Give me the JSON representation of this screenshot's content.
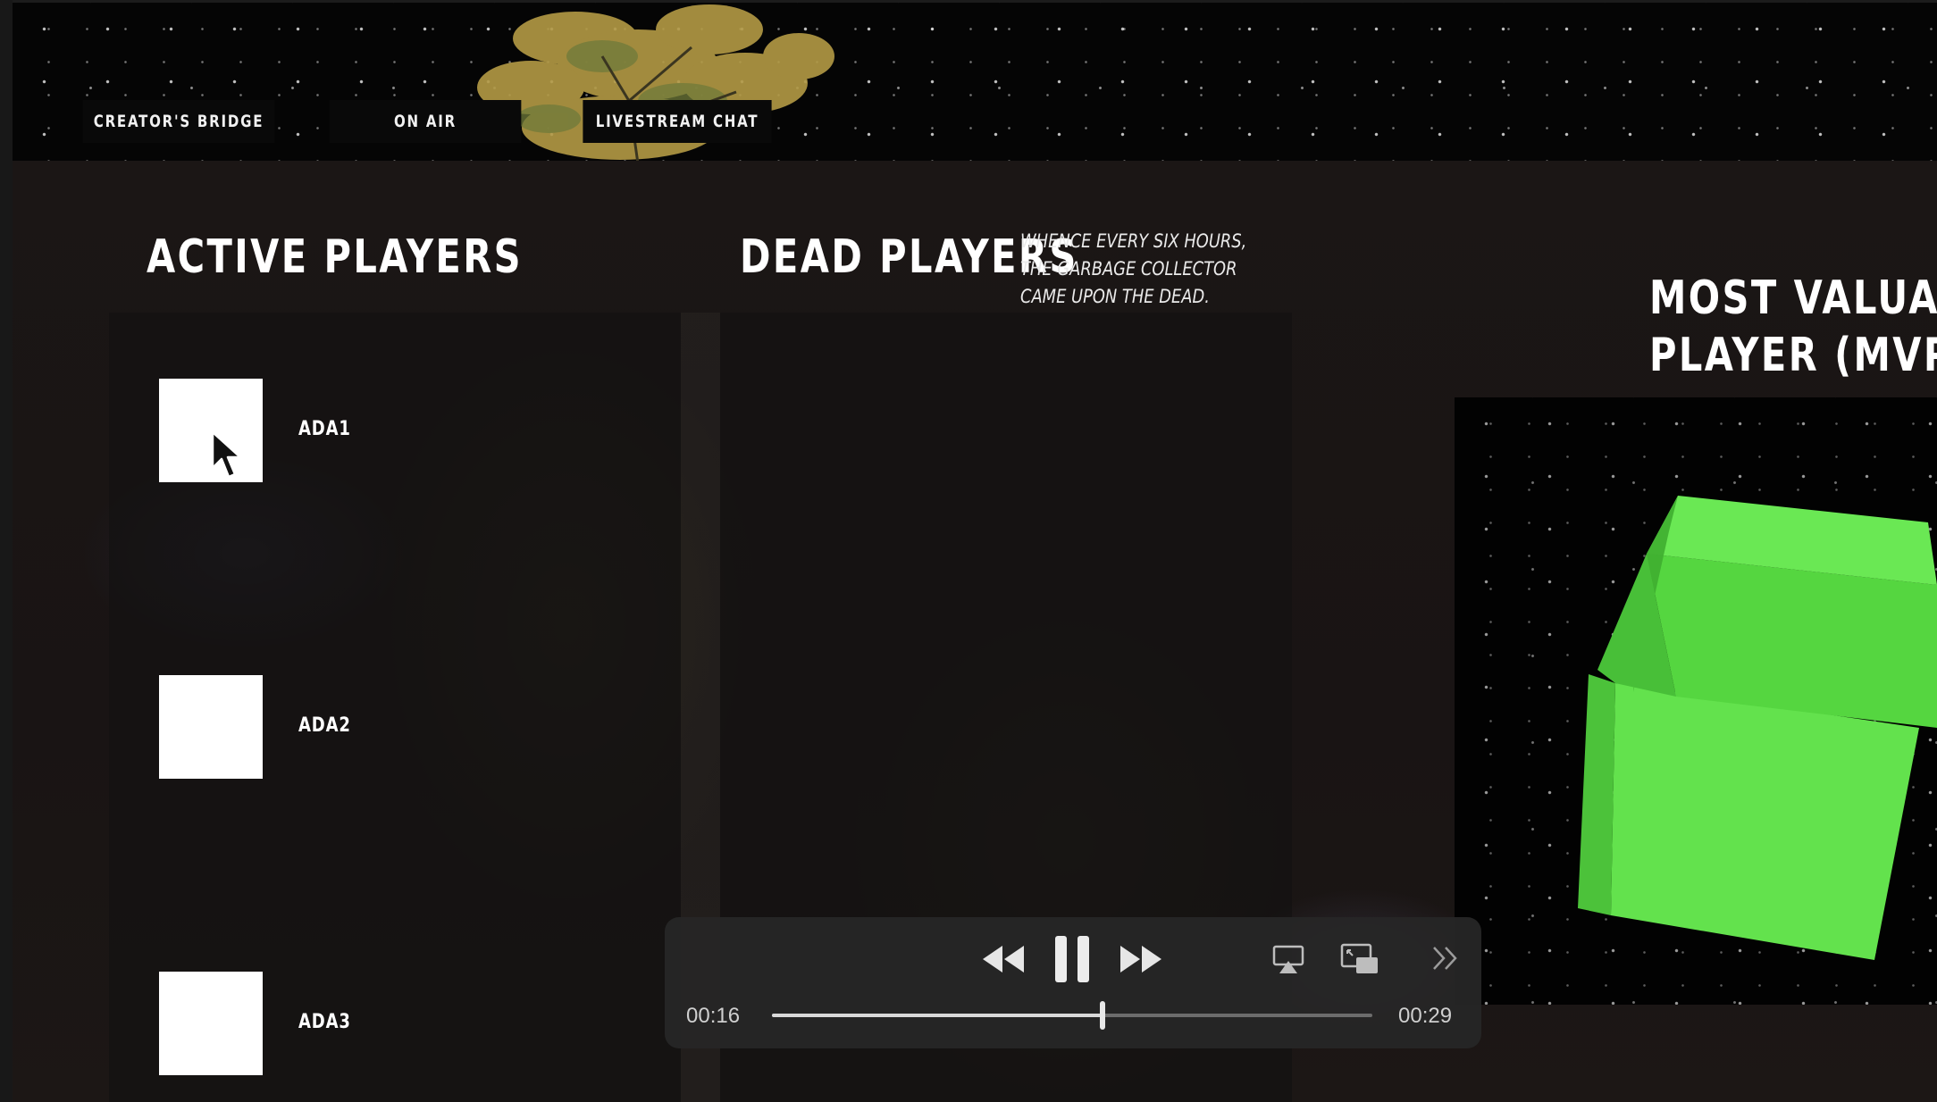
{
  "nav": {
    "creators_bridge": "CREATOR'S BRIDGE",
    "on_air": "ON AIR",
    "livestream_chat": "LIVESTREAM CHAT"
  },
  "sections": {
    "active_title": "ACTIVE PLAYERS",
    "dead_title": "DEAD PLAYERS",
    "dead_note": "WHENCE EVERY SIX HOURS, THE GARBAGE COLLECTOR CAME UPON THE DEAD.",
    "mvp_title_line1": "MOST VALUABLE",
    "mvp_title_line2": "PLAYER (MVP)"
  },
  "active_players": [
    {
      "name": "ADA1"
    },
    {
      "name": "ADA2"
    },
    {
      "name": "ADA3"
    }
  ],
  "player": {
    "current_time": "00:16",
    "duration": "00:29",
    "progress": 0.55,
    "icons": [
      "rewind-icon",
      "pause-icon",
      "fast-forward-icon",
      "airplay-icon",
      "picture-in-picture-icon",
      "more-controls-icon"
    ]
  },
  "colors": {
    "mvp_cube": "#5fe04a",
    "nav_button_bg": "#090909",
    "controller_bg": "#262626"
  }
}
